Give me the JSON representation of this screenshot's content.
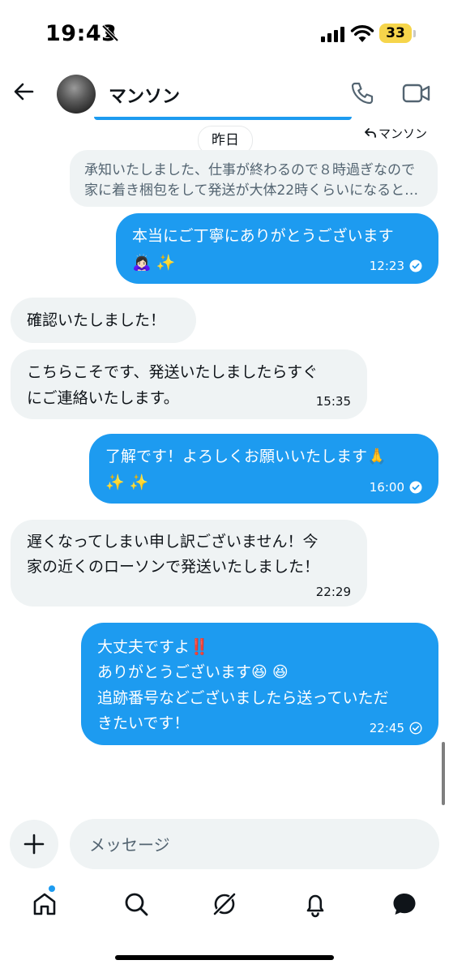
{
  "status": {
    "time": "19:43",
    "battery": "33"
  },
  "header": {
    "name": "マンソン"
  },
  "thread": {
    "date_label": "昨日",
    "reply_to": "マンソン",
    "quoted_lines": [
      "承知いたしました、仕事が終わるので８時過ぎなので",
      "家に着き梱包をして発送が大体22時くらいになると…"
    ]
  },
  "messages": [
    {
      "direction": "out",
      "lines": [
        "本当にご丁寧にありがとうございます",
        "🙇🏻‍♀️ ✨"
      ],
      "time": "12:23"
    },
    {
      "direction": "in",
      "lines": [
        "確認いたしました！"
      ],
      "time": ""
    },
    {
      "direction": "in",
      "lines": [
        "こちらこそです、発送いたしましたらすぐ",
        "にご連絡いたします。"
      ],
      "time": "15:35"
    },
    {
      "direction": "out",
      "lines": [
        "了解です！よろしくお願いいたします🙏",
        "✨ ✨"
      ],
      "time": "16:00"
    },
    {
      "direction": "in",
      "lines": [
        "遅くなってしまい申し訳ございません！今",
        "家の近くのローソンで発送いたしました！"
      ],
      "time": "22:29"
    },
    {
      "direction": "out",
      "lines": [
        "大丈夫ですよ‼️",
        "ありがとうございます😆 😆",
        "追跡番号などございましたら送っていただ",
        "きたいです！"
      ],
      "time": "22:45"
    }
  ],
  "composer": {
    "placeholder": "メッセージ"
  },
  "colors": {
    "accent": "#1d9bf0",
    "incoming_bubble": "#eff3f4",
    "text": "#0f1419",
    "muted": "#536471"
  },
  "icons": [
    "back-arrow-icon",
    "phone-icon",
    "video-icon",
    "plus-icon",
    "home-icon",
    "search-icon",
    "grok-icon",
    "bell-icon",
    "messages-icon"
  ]
}
